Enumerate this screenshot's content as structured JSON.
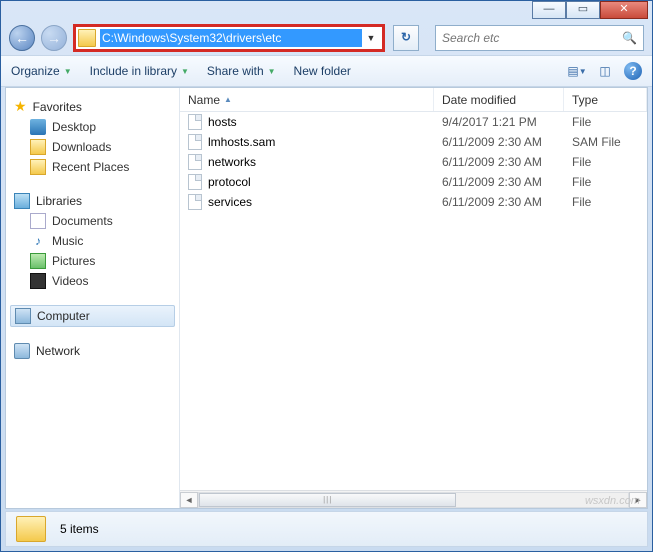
{
  "titlebar": {
    "min": "—",
    "max": "▭",
    "close": "✕"
  },
  "nav": {
    "address": "C:\\Windows\\System32\\drivers\\etc",
    "refresh_glyph": "↻",
    "search_placeholder": "Search etc"
  },
  "toolbar": {
    "organize": "Organize",
    "include": "Include in library",
    "share": "Share with",
    "newfolder": "New folder"
  },
  "sidebar": {
    "favorites": {
      "label": "Favorites",
      "items": [
        "Desktop",
        "Downloads",
        "Recent Places"
      ]
    },
    "libraries": {
      "label": "Libraries",
      "items": [
        "Documents",
        "Music",
        "Pictures",
        "Videos"
      ]
    },
    "computer": "Computer",
    "network": "Network"
  },
  "columns": {
    "name": "Name",
    "date": "Date modified",
    "type": "Type"
  },
  "files": [
    {
      "name": "hosts",
      "date": "9/4/2017 1:21 PM",
      "type": "File"
    },
    {
      "name": "lmhosts.sam",
      "date": "6/11/2009 2:30 AM",
      "type": "SAM File"
    },
    {
      "name": "networks",
      "date": "6/11/2009 2:30 AM",
      "type": "File"
    },
    {
      "name": "protocol",
      "date": "6/11/2009 2:30 AM",
      "type": "File"
    },
    {
      "name": "services",
      "date": "6/11/2009 2:30 AM",
      "type": "File"
    }
  ],
  "status": {
    "count": "5 items"
  },
  "watermark": "wsxdn.com"
}
